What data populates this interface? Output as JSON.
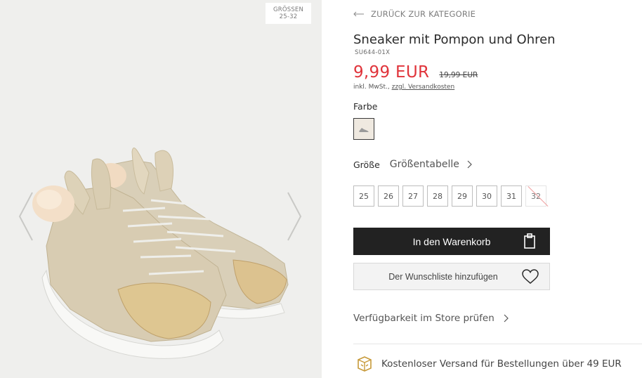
{
  "gallery": {
    "size_badge_label": "GRÖSSEN",
    "size_badge_range": "25-32",
    "image_icon": "sneaker-photo",
    "prev_icon": "chevron-left-icon",
    "next_icon": "chevron-right-icon"
  },
  "product": {
    "back_link": "ZURÜCK ZUR KATEGORIE",
    "title": "Sneaker mit Pompon und Ohren",
    "sku": "SU644-01X",
    "price_now": "9,99 EUR",
    "price_old": "19,99 EUR",
    "tax_prefix": "inkl. MwSt.,",
    "tax_link": "zzgl. Versandkosten",
    "color_label": "Farbe",
    "size_label": "Größe",
    "size_table_link": "Größentabelle",
    "sizes": [
      {
        "label": "25",
        "available": true
      },
      {
        "label": "26",
        "available": true
      },
      {
        "label": "27",
        "available": true
      },
      {
        "label": "28",
        "available": true
      },
      {
        "label": "29",
        "available": true
      },
      {
        "label": "30",
        "available": true
      },
      {
        "label": "31",
        "available": true
      },
      {
        "label": "32",
        "available": false
      }
    ],
    "add_to_cart": "In den Warenkorb",
    "add_to_wishlist": "Der Wunschliste hinzufügen",
    "store_availability": "Verfügbarkeit im Store prüfen",
    "shipping_note": "Kostenloser Versand für Bestellungen über 49 EUR"
  },
  "colors": {
    "price_red": "#e0343b",
    "cart_button": "#222222",
    "swatch": "#efe9e0",
    "gold_icon": "#c79a3a"
  }
}
